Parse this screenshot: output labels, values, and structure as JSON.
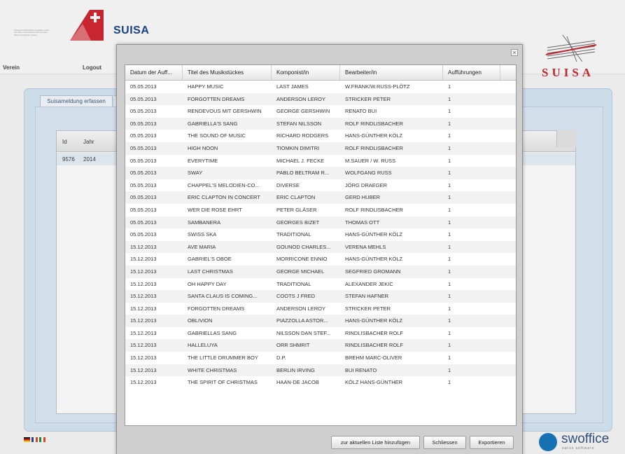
{
  "header": {
    "org_text": "Schweizer Musikeditoren Association suisse des éditeurs Associazione svizzera editori Editeurs suisses de musique",
    "brand": "SUISA",
    "nav_verein": "Verein",
    "nav_logout": "Logout",
    "suisa_wordmark": "SUISA"
  },
  "main": {
    "tab_label": "Suisameldung erfassen",
    "table": {
      "columns": [
        "Id",
        "Jahr"
      ],
      "rows": [
        [
          "9576",
          "2014"
        ]
      ]
    }
  },
  "footer": {
    "swoffice_name": "swoffice",
    "swoffice_sub": "swiss software"
  },
  "dialog": {
    "close_glyph": "×",
    "columns": [
      "Datum der Auff...",
      "Titel des Musikstückes",
      "Komponist/in",
      "Bearbeiter/in",
      "Aufführungen"
    ],
    "rows": [
      [
        "05.05.2013",
        "HAPPY MUSIC",
        "LAST JAMES",
        "W.FRANK/W.RUSS-PLÖTZ",
        "1"
      ],
      [
        "05.05.2013",
        "FORGOTTEN DREAMS",
        "ANDERSON LEROY",
        "STRICKER PETER",
        "1"
      ],
      [
        "05.05.2013",
        "RENDEVOUS MIT GERSHWIN",
        "GEORGE GERSHWIN",
        "RENATO BUI",
        "1"
      ],
      [
        "05.05.2013",
        "GABRIELLA'S SANG",
        "STEFAN NILSSON",
        "ROLF RINDLISBACHER",
        "1"
      ],
      [
        "05.05.2013",
        "THE SOUND OF MUSIC",
        "RICHARD RODGERS",
        "HANS-GÜNTHER KÖLZ",
        "1"
      ],
      [
        "05.05.2013",
        "HIGH NOON",
        "TIOMKIN DIMITRI",
        "ROLF RINDLISBACHER",
        "1"
      ],
      [
        "05.05.2013",
        "EVERYTIME",
        "MICHAEL J. FECKE",
        "M.SAUER / W. RUSS",
        "1"
      ],
      [
        "05.05.2013",
        "SWAY",
        "PABLO BELTRAM R...",
        "WOLFGANG RUSS",
        "1"
      ],
      [
        "05.05.2013",
        "CHAPPEL'S MELODIEN-CO...",
        "DIVERSE",
        "JÖRG DRAEGER",
        "1"
      ],
      [
        "05.05.2013",
        "ERIC CLAPTON IN CONCERT",
        "ERIC CLAPTON",
        "GERD HUBER",
        "1"
      ],
      [
        "05.05.2013",
        "WER DIE ROSE EHRT",
        "PETER GLÄSER",
        "ROLF RINDLISBACHER",
        "1"
      ],
      [
        "05.05.2013",
        "SAMBANERA",
        "GEORGES BIZET",
        "THOMAS OTT",
        "1"
      ],
      [
        "05.05.2013",
        "SWISS SKA",
        "TRADITIONAL",
        "HANS-GÜNTHER KÖLZ",
        "1"
      ],
      [
        "15.12.2013",
        "AVE MARIA",
        "GOUNOD CHARLES...",
        "VERENA MEHLS",
        "1"
      ],
      [
        "15.12.2013",
        "GABRIEL'S OBOE",
        "MORRICONE ENNIO",
        "HANS-GÜNTHER KÖLZ",
        "1"
      ],
      [
        "15.12.2013",
        "LAST CHRISTMAS",
        "GEORGE MICHAEL",
        "SEGFRIED GROMANN",
        "1"
      ],
      [
        "15.12.2013",
        "OH HAPPY DAY",
        "TRADITIONAL",
        "ALEXANDER JEKIC",
        "1"
      ],
      [
        "15.12.2013",
        "SANTA CLAUS IS COMING...",
        "COOTS J FRED",
        "STEFAN HAFNER",
        "1"
      ],
      [
        "15.12.2013",
        "FORGOTTEN DREAMS",
        "ANDERSON LEROY",
        "STRICKER PETER",
        "1"
      ],
      [
        "15.12.2013",
        "OBLIVION",
        "PIAZZOLLA ASTOR...",
        "HANS-GÜNTHER KÖLZ",
        "1"
      ],
      [
        "15.12.2013",
        "GABRIELLAS SANG",
        "NILSSON DAN STEF...",
        "RINDLISBACHER ROLF",
        "1"
      ],
      [
        "15.12.2013",
        "HALLELUYA",
        "ORR SHMRIT",
        "RINDLISBACHER ROLF",
        "1"
      ],
      [
        "15.12.2013",
        "THE LITTLE DRUMMER BOY",
        "D.P.",
        "BREHM MARC-OLIVER",
        "1"
      ],
      [
        "15.12.2013",
        "WHITE CHRISTMAS",
        "BERLIN IRVING",
        "BUI RENATO",
        "1"
      ],
      [
        "15.12.2013",
        "THE SPIRIT OF CHRISTMAS",
        "HAAN-DE JACOB",
        "KÖLZ HANS-GÜNTHER",
        "1"
      ]
    ],
    "buttons": {
      "add_to_list": "zur aktuellen Liste hinzufügen",
      "close": "Schliessen",
      "export": "Exportieren"
    }
  },
  "colors": {
    "brand_blue": "#123d8a",
    "suisa_red": "#c8202a",
    "panel_blue": "#d5e5f4"
  }
}
